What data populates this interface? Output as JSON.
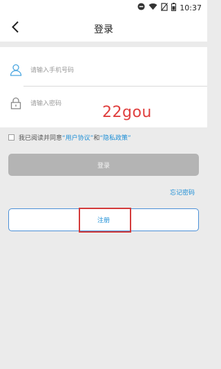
{
  "status_bar": {
    "time": "10:37",
    "icons": [
      "do-not-disturb-icon",
      "wifi-icon",
      "no-sim-icon",
      "battery-icon"
    ]
  },
  "app_bar": {
    "title": "登录",
    "back_icon": "chevron-left-icon"
  },
  "login_form": {
    "phone_placeholder": "请输入手机号码",
    "password_placeholder": "请输入密码"
  },
  "watermark": "22gou",
  "agreement": {
    "prefix": "我已阅读并同意",
    "user_agreement": "“用户协议”",
    "conjunction": "和",
    "privacy_policy": "“隐私政策”"
  },
  "buttons": {
    "login": "登录",
    "forgot_password": "忘记密码",
    "register": "注册"
  },
  "colors": {
    "accent": "#1e8fd6",
    "login_disabled": "#b4b4b4",
    "highlight": "#d33a3a",
    "background": "#ebebeb"
  }
}
